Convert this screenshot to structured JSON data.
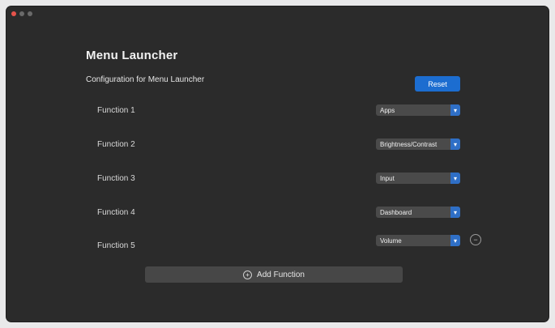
{
  "header": {
    "title": "Menu Launcher",
    "subtitle": "Configuration for Menu Launcher"
  },
  "toolbar": {
    "reset_label": "Reset"
  },
  "functions": [
    {
      "label": "Function 1",
      "value": "Apps"
    },
    {
      "label": "Function 2",
      "value": "Brightness/Contrast"
    },
    {
      "label": "Function 3",
      "value": "Input"
    },
    {
      "label": "Function 4",
      "value": "Dashboard"
    },
    {
      "label": "Function 5",
      "value": "Volume"
    }
  ],
  "add_function": {
    "label": "Add Function"
  },
  "icons": {
    "chevron": "chevron-down-icon",
    "remove": "remove-icon",
    "add": "plus-circle-icon"
  },
  "colors": {
    "window_bg": "#2b2b2b",
    "accent": "#1c6dd0",
    "select_bg": "#4a4a4a",
    "button_bg": "#474747"
  }
}
